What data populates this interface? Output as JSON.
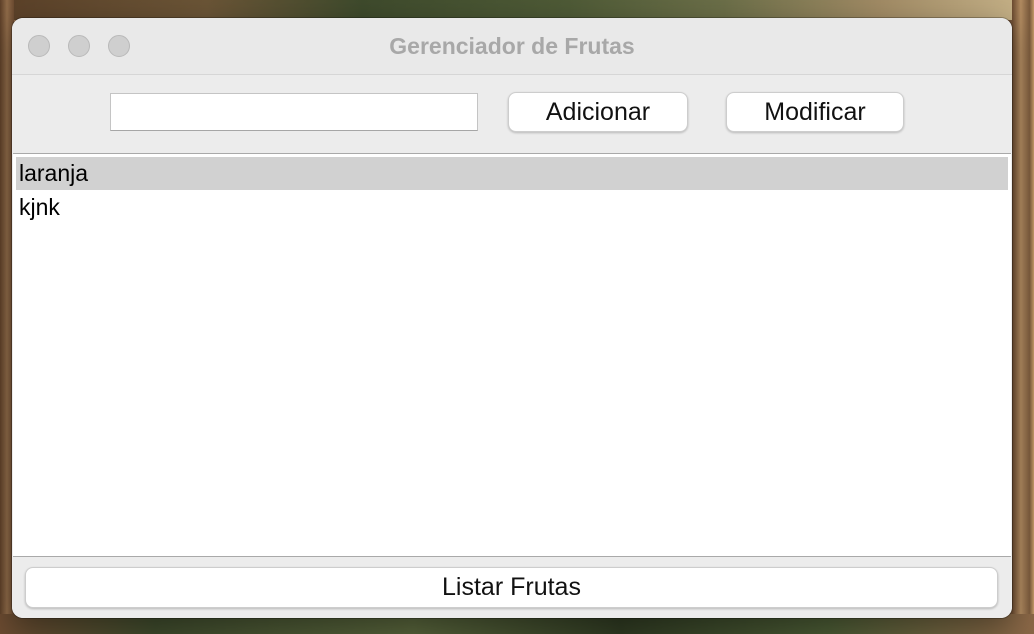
{
  "window": {
    "title": "Gerenciador de Frutas"
  },
  "toolbar": {
    "input_value": "",
    "add_label": "Adicionar",
    "modify_label": "Modificar"
  },
  "list": {
    "items": [
      {
        "label": "laranja",
        "selected": true
      },
      {
        "label": "kjnk",
        "selected": false
      }
    ]
  },
  "footer": {
    "list_label": "Listar Frutas"
  },
  "colors": {
    "selection": "#d1d1d1",
    "window_bg": "#ececec",
    "title_text": "#a8a8a8"
  },
  "icons": [
    "close-window-icon",
    "minimize-window-icon",
    "zoom-window-icon"
  ]
}
